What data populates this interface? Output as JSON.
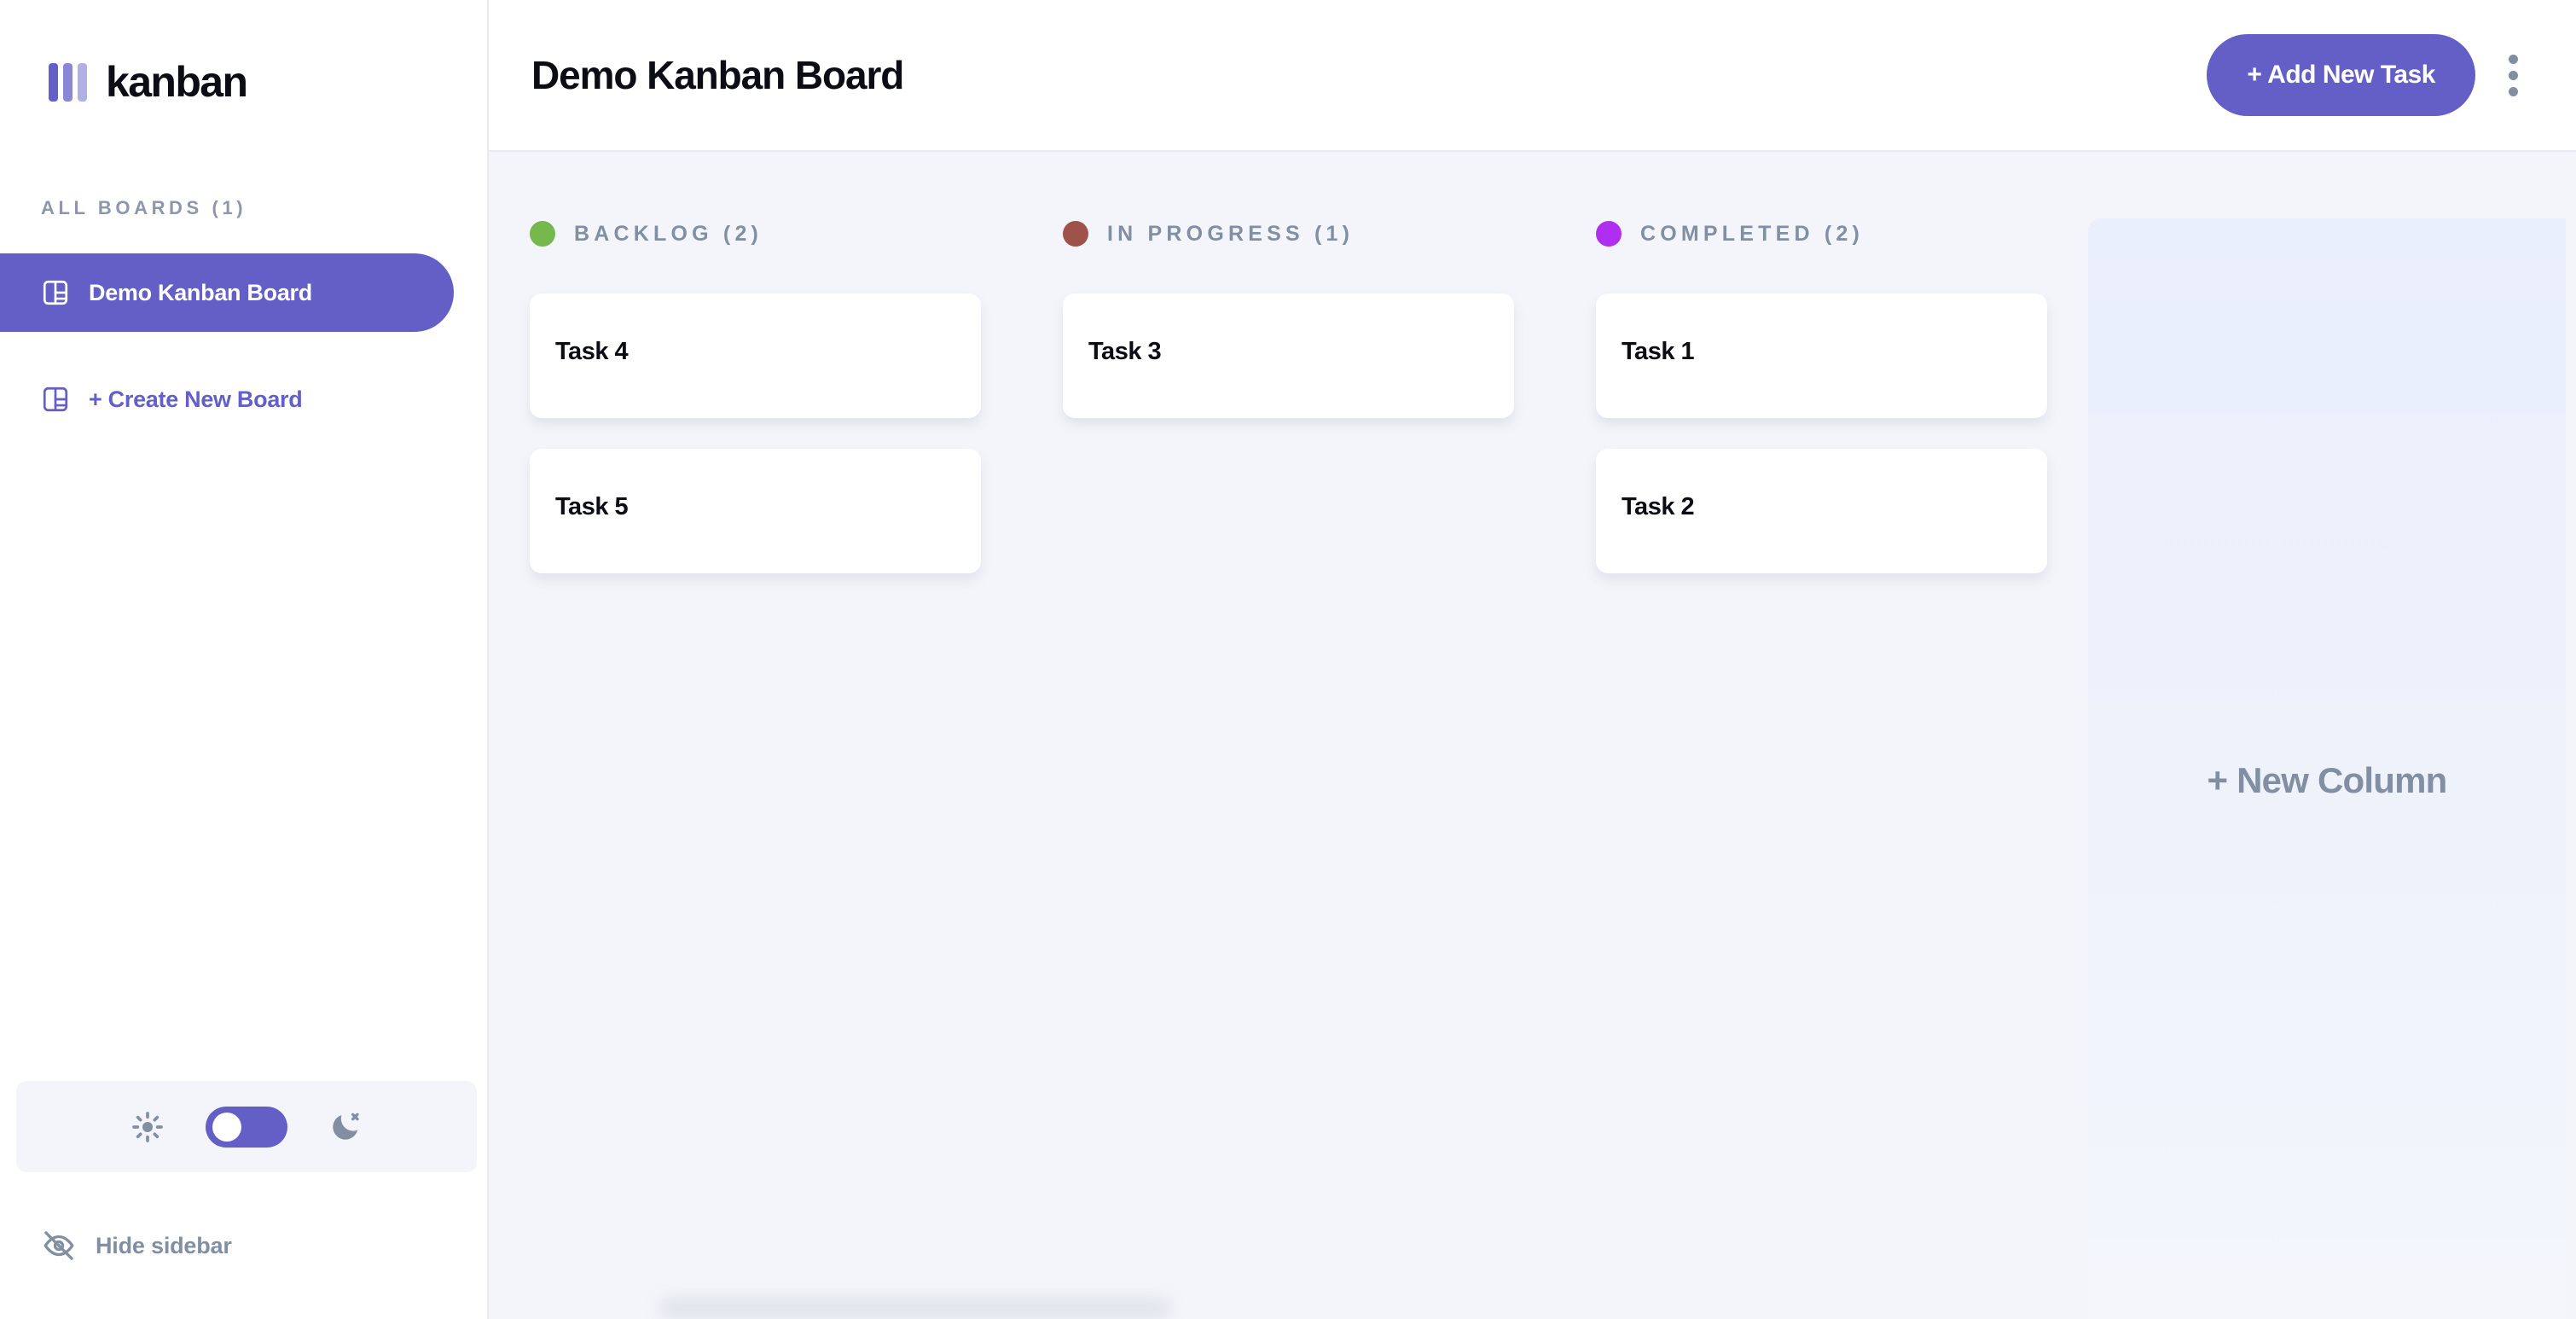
{
  "app": {
    "logo_text": "kanban",
    "accent_color": "#635fc7"
  },
  "sidebar": {
    "all_boards_label": "ALL BOARDS (1)",
    "boards": [
      {
        "label": "Demo Kanban Board",
        "active": true
      },
      {
        "label": "+ Create New Board",
        "active": false
      }
    ],
    "theme_toggle": {
      "light_icon": "sun-icon",
      "dark_icon": "moon-icon",
      "state": "light",
      "knob_position": "left"
    },
    "hide_sidebar_label": "Hide sidebar",
    "hide_sidebar_icon": "eye-off-icon"
  },
  "header": {
    "title": "Demo Kanban Board",
    "add_task_label": "+ Add New Task",
    "menu_icon": "kebab-menu-icon"
  },
  "board": {
    "new_column_label": "+ New Column",
    "columns": [
      {
        "name": "BACKLOG (2)",
        "dot_color": "#76b84c",
        "tasks": [
          {
            "title": "Task 4"
          },
          {
            "title": "Task 5"
          }
        ]
      },
      {
        "name": "IN PROGRESS (1)",
        "dot_color": "#9f5249",
        "tasks": [
          {
            "title": "Task 3"
          }
        ]
      },
      {
        "name": "COMPLETED (2)",
        "dot_color": "#af2ef0",
        "tasks": [
          {
            "title": "Task 1"
          },
          {
            "title": "Task 2"
          }
        ]
      }
    ]
  }
}
